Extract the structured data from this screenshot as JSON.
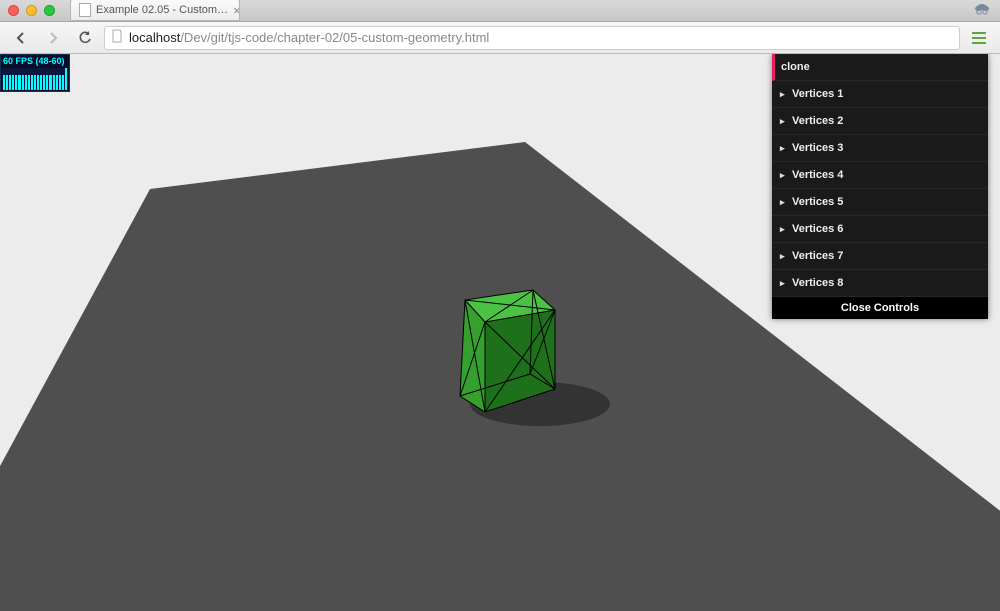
{
  "window": {
    "tab_title": "Example 02.05 - Custom…"
  },
  "addressbar": {
    "host": "localhost",
    "path": "/Dev/git/tjs-code/chapter-02/05-custom-geometry.html"
  },
  "stats": {
    "text": "60 FPS (48-60)"
  },
  "gui": {
    "action": "clone",
    "folders": [
      "Vertices 1",
      "Vertices 2",
      "Vertices 3",
      "Vertices 4",
      "Vertices 5",
      "Vertices 6",
      "Vertices 7",
      "Vertices 8"
    ],
    "close": "Close Controls"
  },
  "scene": {
    "ground_fill": "#4f4f4f",
    "cube_colors": {
      "front": "#35a02e",
      "side": "#1e701b",
      "top": "#4cc245"
    },
    "wire_color": "#000000"
  }
}
